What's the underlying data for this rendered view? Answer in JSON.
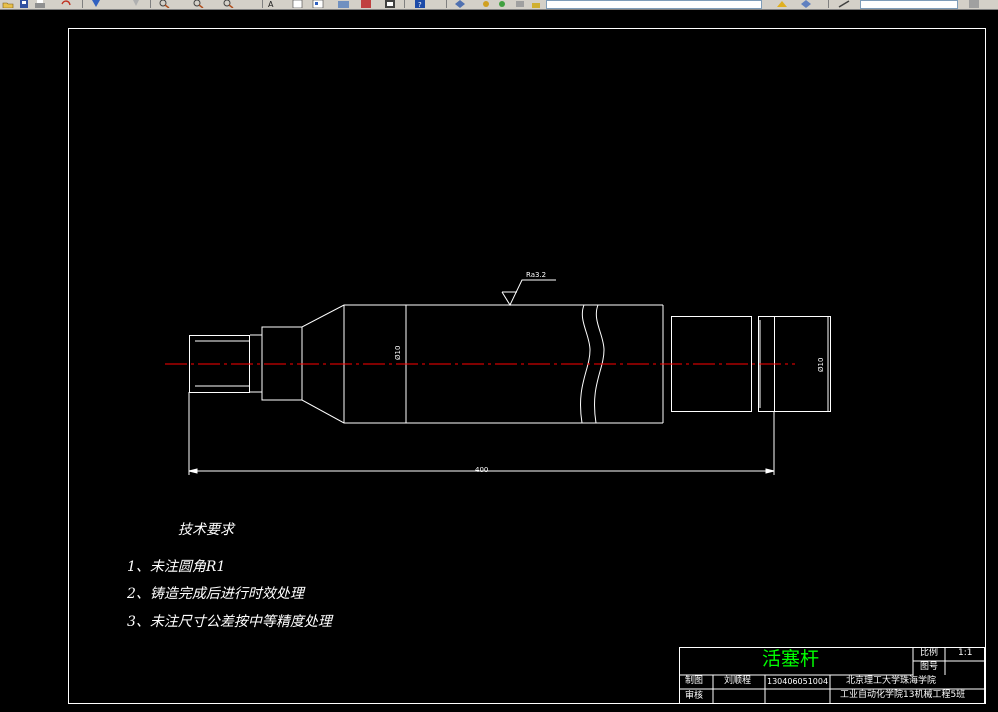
{
  "toolbar": {
    "icons": [
      "open-icon",
      "save-icon",
      "print-icon",
      "undo-icon",
      "redo-icon",
      "pan-icon",
      "zoom-realtime-icon",
      "zoom-window-icon",
      "zoom-previous-icon",
      "text-style-icon",
      "properties-icon",
      "design-center-icon",
      "tool-palettes-icon",
      "calculator-icon",
      "layers-icon",
      "layer-previous-icon",
      "match-properties-icon",
      "help-icon"
    ],
    "colors": {
      "face": "#d4d0c8",
      "shadow": "#808080"
    }
  },
  "drawing": {
    "surface_finish": "Ra3.2",
    "dim_diameter_left": "Ø10",
    "dim_diameter_right": "Ø10",
    "dim_length": "400",
    "tech_title": "技术要求",
    "tech_items": [
      "1、未注圆角R1",
      "2、铸造完成后进行时效处理",
      "3、未注尺寸公差按中等精度处理"
    ],
    "colors": {
      "outline": "#ffffff",
      "centerline": "#ff0000",
      "title": "#00ff00"
    }
  },
  "title_block": {
    "part_name": "活塞杆",
    "scale_label": "比例",
    "scale_value": "1:1",
    "drawing_no_label": "图号",
    "drawn_label": "制图",
    "drawn_by": "刘顺程",
    "student_id": "130406051004",
    "checked_label": "审核",
    "school": "北京理工大学珠海学院",
    "department": "工业自动化学院13机械工程5班"
  }
}
